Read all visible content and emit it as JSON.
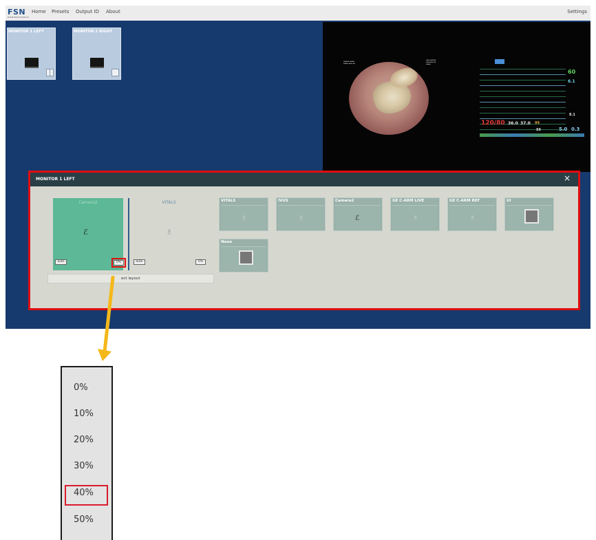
{
  "nav": {
    "logo": "FSN",
    "logo_sub": "AUDIOVISUALS",
    "items": [
      "Home",
      "Presets",
      "Output ID",
      "About"
    ],
    "settings": "Settings"
  },
  "monitors": [
    {
      "title": "MONITOR 1 LEFT"
    },
    {
      "title": "MONITOR 2 RIGHT"
    }
  ],
  "vitals_display": {
    "bp": "120/80",
    "temp1": "36.0",
    "temp2": "37.0",
    "spo2_small": "99",
    "hr": "60",
    "v2": "6.1",
    "v3": "88",
    "v4": "5.0",
    "v5": "0.3",
    "v6": "8.1"
  },
  "dialog": {
    "title": "MONITOR 1 LEFT",
    "close": "×",
    "slots": [
      {
        "name": "Camera2",
        "mode": "auto",
        "percent": "0%"
      },
      {
        "name": "VITALS",
        "mode": "auto",
        "percent": "0%"
      }
    ],
    "select_layout": "ect layout",
    "sources": [
      {
        "label": "VITALS"
      },
      {
        "label": "IVUS"
      },
      {
        "label": "Camera2"
      },
      {
        "label": "GE C-ARM LIVE"
      },
      {
        "label": "GE C-ARM REF"
      },
      {
        "label": "UI"
      },
      {
        "label": "None"
      }
    ]
  },
  "percent_options": [
    "0%",
    "10%",
    "20%",
    "30%",
    "40%",
    "50%"
  ],
  "highlighted_option": "40%",
  "colors": {
    "screen": "#173a6e",
    "dialog_border": "#e00d10",
    "selected_slot": "#5cb896",
    "arrow": "#f5b81a"
  }
}
